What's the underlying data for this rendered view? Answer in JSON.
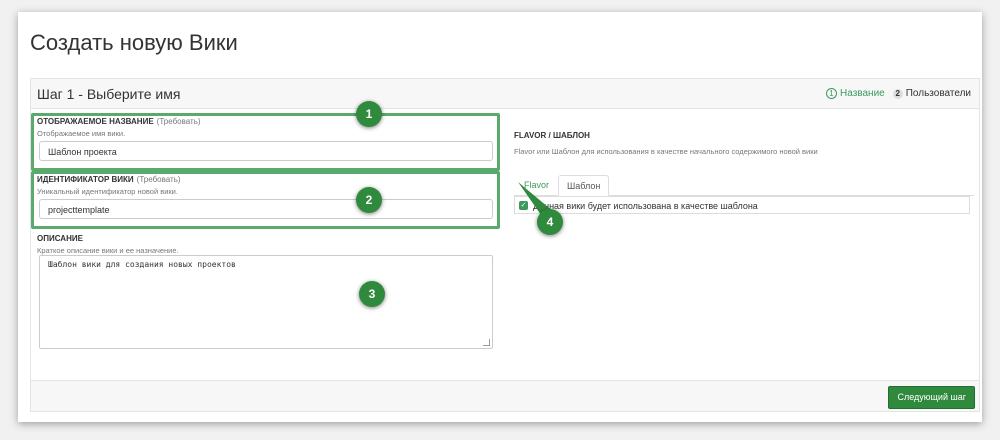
{
  "page": {
    "title": "Создать новую Вики"
  },
  "wizard": {
    "step_title": "Шаг 1 - Выберите имя",
    "steps": [
      {
        "num": "1",
        "label": "Название"
      },
      {
        "num": "2",
        "label": "Пользователи"
      }
    ]
  },
  "form": {
    "display_name": {
      "label": "ОТОБРАЖАЕМОЕ НАЗВАНИЕ",
      "required": "(Требовать)",
      "help": "Отображаемое имя вики.",
      "value": "Шаблон проекта"
    },
    "wiki_id": {
      "label": "ИДЕНТИФИКАТОР ВИКИ",
      "required": "(Требовать)",
      "help": "Уникальный идентификатор новой вики.",
      "value": "projecttemplate"
    },
    "description": {
      "label": "ОПИСАНИЕ",
      "help": "Краткое описание вики и ее назначение.",
      "value": "Шаблон вики для создания новых проектов"
    }
  },
  "flavor": {
    "title": "FLAVOR / ШАБЛОН",
    "help": "Flavor или Шаблон для использования в качестве начального содержимого новой вики",
    "tabs": [
      "Flavor",
      "Шаблон"
    ],
    "active_tab": "Шаблон",
    "checkbox_label": "Данная вики будет использована в качестве шаблона",
    "checked": true
  },
  "footer": {
    "next_label": "Следующий шаг"
  },
  "callouts": [
    "1",
    "2",
    "3",
    "4"
  ],
  "colors": {
    "accent": "#2f8a3e",
    "highlight": "#5aa96d"
  }
}
